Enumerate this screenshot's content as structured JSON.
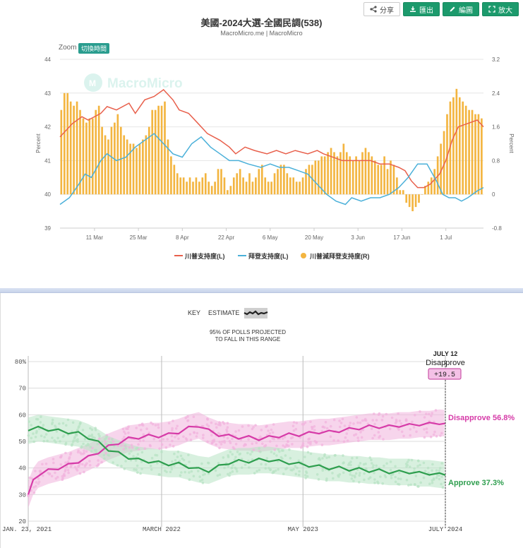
{
  "toolbar": {
    "share": "分享",
    "export": "匯出",
    "edit": "編圖",
    "enlarge": "放大",
    "icons": [
      "share-icon",
      "download-icon",
      "pencil-icon",
      "expand-icon"
    ]
  },
  "top_chart": {
    "title": "美國-2024大選-全國民調(538)",
    "subtitle": "MacroMicro.me | MacroMicro",
    "zoom_label": "Zoom",
    "zoom_button": "切換時間",
    "watermark": "MacroMicro",
    "legend": [
      "川普支持度(L)",
      "拜登支持度(L)",
      "川普減拜登支持度(R)"
    ]
  },
  "bottom_chart": {
    "key_label": "KEY",
    "estimate_label": "ESTIMATE",
    "range_note_1": "95% OF POLLS PROJECTED",
    "range_note_2": "TO FALL IN THIS RANGE",
    "date_label": "JULY 12",
    "metric_label": "Disapprove",
    "metric_value": "+19.5",
    "disapprove_label": "Disapprove 56.8%",
    "approve_label": "Approve 37.3%"
  },
  "chart_data": [
    {
      "type": "line",
      "title": "美國-2024大選-全國民調(538)",
      "subtitle": "MacroMicro.me | MacroMicro",
      "ylabel_left": "Percent",
      "ylabel_right": "Percent",
      "ylim_left": [
        39,
        44
      ],
      "yticks_left": [
        "44",
        "43",
        "42",
        "41",
        "40",
        "39"
      ],
      "ylim_right": [
        -0.8,
        3.2
      ],
      "yticks_right": [
        "3.2",
        "2.4",
        "1.6",
        "0.8",
        "0",
        "-0.8"
      ],
      "x_ticks": [
        "11 Mar",
        "25 Mar",
        "8 Apr",
        "22 Apr",
        "6 May",
        "20 May",
        "3 Jun",
        "17 Jun",
        "1 Jul"
      ],
      "x_tick_days": [
        11,
        25,
        39,
        53,
        67,
        81,
        95,
        109,
        123
      ],
      "x_range_days": [
        0,
        135
      ],
      "grid": true,
      "legend_position": "bottom",
      "series": [
        {
          "name": "川普支持度(L)",
          "axis": "left",
          "kind": "line",
          "color": "#e8604c",
          "x": [
            0,
            4,
            7,
            9,
            13,
            15,
            18,
            22,
            24,
            27,
            30,
            33,
            36,
            38,
            41,
            44,
            47,
            51,
            54,
            56,
            59,
            62,
            66,
            69,
            72,
            75,
            79,
            82,
            84,
            87,
            90,
            93,
            96,
            99,
            102,
            105,
            108,
            110,
            112,
            114,
            116,
            118,
            121,
            123,
            125,
            127,
            130,
            133,
            135
          ],
          "y": [
            41.7,
            42.1,
            42.3,
            42.2,
            42.4,
            42.6,
            42.5,
            42.7,
            42.4,
            42.8,
            42.9,
            43.1,
            42.8,
            42.5,
            42.4,
            42.1,
            41.8,
            41.6,
            41.4,
            41.2,
            41.4,
            41.3,
            41.2,
            41.3,
            41.2,
            41.3,
            41.2,
            41.3,
            41.2,
            41.1,
            41.0,
            41.0,
            41.0,
            41.0,
            40.9,
            40.9,
            40.8,
            40.7,
            40.4,
            40.2,
            40.2,
            40.3,
            40.6,
            41.0,
            41.6,
            42.0,
            42.1,
            42.2,
            42.0
          ]
        },
        {
          "name": "拜登支持度(L)",
          "axis": "left",
          "kind": "line",
          "color": "#4ab0d9",
          "x": [
            0,
            3,
            6,
            8,
            10,
            13,
            15,
            18,
            21,
            24,
            27,
            30,
            33,
            36,
            39,
            42,
            45,
            48,
            51,
            54,
            57,
            60,
            64,
            67,
            70,
            73,
            76,
            79,
            82,
            85,
            88,
            91,
            93,
            96,
            99,
            102,
            105,
            108,
            111,
            114,
            117,
            120,
            122,
            124,
            126,
            128,
            130,
            133,
            135
          ],
          "y": [
            39.7,
            39.9,
            40.3,
            40.6,
            40.5,
            41.0,
            41.2,
            41.0,
            41.1,
            41.4,
            41.6,
            41.8,
            41.5,
            41.2,
            41.1,
            41.5,
            41.7,
            41.4,
            41.2,
            41.0,
            41.0,
            40.9,
            40.8,
            40.9,
            40.8,
            40.8,
            40.7,
            40.6,
            40.3,
            40.0,
            39.8,
            39.7,
            39.9,
            39.8,
            39.9,
            39.9,
            40.0,
            40.2,
            40.5,
            40.9,
            40.9,
            40.4,
            40.0,
            39.9,
            39.9,
            39.8,
            39.9,
            40.1,
            40.2
          ]
        },
        {
          "name": "川普減拜登支持度(R)",
          "axis": "right",
          "kind": "bar",
          "color": "#f3b540",
          "x": [
            0,
            1,
            2,
            3,
            4,
            5,
            6,
            7,
            8,
            9,
            10,
            11,
            12,
            13,
            14,
            15,
            16,
            17,
            18,
            19,
            20,
            21,
            22,
            23,
            24,
            25,
            26,
            27,
            28,
            29,
            30,
            31,
            32,
            33,
            34,
            35,
            36,
            37,
            38,
            39,
            40,
            41,
            42,
            43,
            44,
            45,
            46,
            47,
            48,
            49,
            50,
            51,
            52,
            53,
            54,
            55,
            56,
            57,
            58,
            59,
            60,
            61,
            62,
            63,
            64,
            65,
            66,
            67,
            68,
            69,
            70,
            71,
            72,
            73,
            74,
            75,
            76,
            77,
            78,
            79,
            80,
            81,
            82,
            83,
            84,
            85,
            86,
            87,
            88,
            89,
            90,
            91,
            92,
            93,
            94,
            95,
            96,
            97,
            98,
            99,
            100,
            101,
            102,
            103,
            104,
            105,
            106,
            107,
            108,
            109,
            110,
            111,
            112,
            113,
            114,
            115,
            116,
            117,
            118,
            119,
            120,
            121,
            122,
            123,
            124,
            125,
            126,
            127,
            128,
            129,
            130,
            131,
            132,
            133,
            134
          ],
          "y": [
            2.0,
            2.4,
            2.4,
            2.2,
            2.1,
            2.2,
            2.0,
            1.8,
            1.7,
            1.8,
            1.8,
            2.0,
            2.1,
            1.6,
            1.4,
            1.3,
            1.6,
            1.7,
            1.9,
            1.6,
            1.4,
            1.3,
            1.2,
            1.2,
            1.1,
            1.2,
            1.3,
            1.4,
            1.6,
            2.0,
            2.0,
            2.1,
            2.1,
            2.2,
            1.3,
            0.9,
            0.7,
            0.5,
            0.4,
            0.4,
            0.3,
            0.4,
            0.3,
            0.4,
            0.3,
            0.4,
            0.5,
            0.3,
            0.2,
            0.3,
            0.6,
            0.6,
            0.4,
            0.1,
            0.2,
            0.4,
            0.5,
            0.6,
            0.4,
            0.3,
            0.5,
            0.3,
            0.4,
            0.6,
            0.7,
            0.4,
            0.3,
            0.3,
            0.5,
            0.6,
            0.7,
            0.7,
            0.5,
            0.4,
            0.4,
            0.3,
            0.3,
            0.4,
            0.6,
            0.7,
            0.7,
            0.8,
            0.8,
            0.9,
            0.9,
            1.0,
            1.1,
            1.0,
            0.9,
            1.0,
            1.2,
            1.0,
            0.9,
            0.8,
            0.9,
            0.8,
            1.0,
            1.1,
            1.0,
            0.9,
            0.8,
            0.7,
            0.7,
            0.9,
            0.6,
            0.8,
            0.7,
            0.4,
            0.1,
            0.1,
            -0.2,
            -0.3,
            -0.4,
            -0.3,
            -0.2,
            0.0,
            0.2,
            0.3,
            0.4,
            0.6,
            0.9,
            1.2,
            1.5,
            1.9,
            2.2,
            2.3,
            2.5,
            2.3,
            2.2,
            2.1,
            2.0,
            2.0,
            1.9,
            1.9,
            1.8
          ]
        }
      ]
    },
    {
      "type": "line",
      "title": "",
      "ylim": [
        20,
        80
      ],
      "yticks": [
        "80%",
        "70",
        "60",
        "50",
        "40",
        "30",
        "20"
      ],
      "x_ticks": [
        "JAN. 23, 2021",
        "MARCH 2022",
        "MAY 2023",
        "JULY 2024"
      ],
      "x_tick_months": [
        0,
        13.3,
        27.4,
        41.6
      ],
      "x_range_months": [
        0,
        41.6
      ],
      "grid": true,
      "annotation": {
        "date": "JULY 12",
        "label": "Disapprove",
        "value": "+19.5"
      },
      "series": [
        {
          "name": "Disapprove",
          "color": "#d63ba8",
          "band_color": "#f1b3dd",
          "end_label": "Disapprove 56.8%",
          "x": [
            0,
            0.5,
            1,
            2,
            3,
            4,
            5,
            6,
            7,
            8,
            9,
            10,
            11,
            12,
            13,
            14,
            15,
            16,
            17,
            18,
            19,
            20,
            21,
            22,
            23,
            24,
            25,
            26,
            27,
            28,
            29,
            30,
            31,
            32,
            33,
            34,
            35,
            36,
            37,
            38,
            39,
            40,
            41,
            41.6
          ],
          "y": [
            30,
            35,
            37.5,
            39,
            40,
            41,
            42.5,
            44,
            46,
            48,
            49.5,
            51,
            51.5,
            52,
            52,
            52.5,
            53.5,
            55,
            56,
            54,
            52.5,
            52,
            51.5,
            51.5,
            51,
            51.5,
            52,
            52.5,
            52.5,
            53,
            53.5,
            53.5,
            54,
            54.5,
            55,
            55.5,
            55.5,
            55.5,
            56,
            56,
            56.5,
            56.5,
            57,
            56.8
          ]
        },
        {
          "name": "Approve",
          "color": "#2e9e4e",
          "band_color": "#b8e3c4",
          "end_label": "Approve 37.3%",
          "x": [
            0,
            1,
            2,
            3,
            4,
            5,
            6,
            7,
            8,
            9,
            10,
            11,
            12,
            13,
            14,
            15,
            16,
            17,
            18,
            19,
            20,
            21,
            22,
            23,
            24,
            25,
            26,
            27,
            28,
            29,
            30,
            31,
            32,
            33,
            34,
            35,
            36,
            37,
            38,
            39,
            40,
            41,
            41.6
          ],
          "y": [
            54,
            55,
            54.5,
            54,
            53.5,
            53,
            51.5,
            49.5,
            47,
            45.5,
            44,
            43,
            42.5,
            42,
            41.5,
            41.5,
            40.5,
            39.5,
            39,
            40.5,
            42,
            42.5,
            42.5,
            43,
            43,
            42.5,
            42,
            41.5,
            41,
            40.5,
            40,
            40,
            39.5,
            39.5,
            39,
            39,
            38.5,
            38.5,
            38.5,
            38,
            38,
            37.5,
            37.3
          ]
        }
      ]
    }
  ]
}
